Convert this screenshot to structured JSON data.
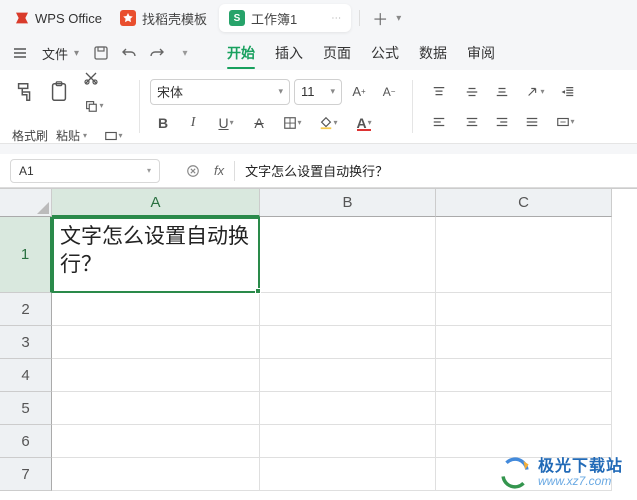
{
  "title_bar": {
    "app_name": "WPS Office",
    "tabs": [
      {
        "label": "找稻壳模板",
        "icon_bg": "#e94f2e"
      },
      {
        "label": "工作簿1",
        "icon_bg": "#27a36a",
        "icon_text": "S",
        "active": true
      }
    ]
  },
  "menu": {
    "file": "文件",
    "items": [
      "开始",
      "插入",
      "页面",
      "公式",
      "数据",
      "审阅"
    ],
    "active_index": 0
  },
  "ribbon": {
    "format_painter": "格式刷",
    "paste": "粘贴",
    "font_name": "宋体",
    "font_size": "11",
    "buttons": {
      "bold": "B",
      "italic": "I",
      "underline": "U",
      "strike": "A"
    }
  },
  "formula_bar": {
    "name_box": "A1",
    "fx": "fx",
    "content": "文字怎么设置自动换行？"
  },
  "grid": {
    "col_widths": {
      "A": 208,
      "B": 176,
      "C": 176
    },
    "row_heights": {
      "1": 76,
      "other": 33
    },
    "columns": [
      "A",
      "B",
      "C"
    ],
    "rows": [
      "1",
      "2",
      "3",
      "4",
      "5",
      "6",
      "7"
    ],
    "selected": "A1",
    "cells": {
      "A1": "文字怎么设置自动换行？"
    }
  },
  "watermark": {
    "name": "极光下载站",
    "url": "www.xz7.com"
  },
  "colors": {
    "accent": "#18a05e",
    "selection_border": "#2a8a4a"
  }
}
